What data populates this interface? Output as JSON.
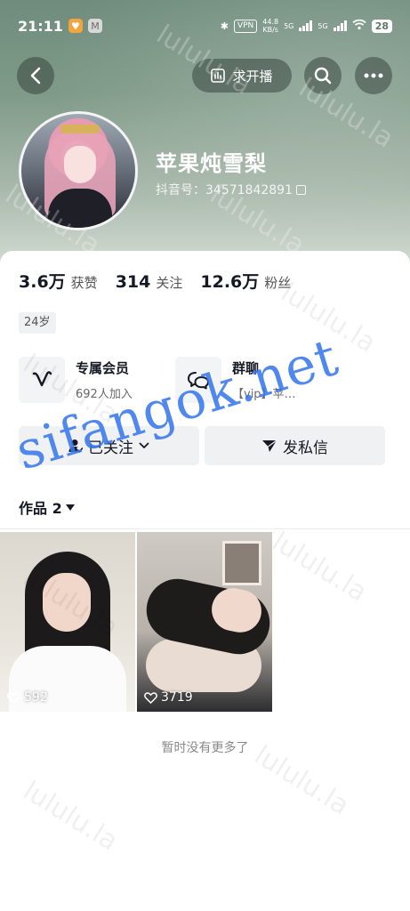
{
  "status_bar": {
    "time": "21:11",
    "vpn": "VPN",
    "net_speed_value": "44.8",
    "net_speed_unit": "KB/s",
    "network_1": "5G",
    "network_2": "5G",
    "battery": "28"
  },
  "nav": {
    "live_request_label": "求开播",
    "icons": [
      "chevron-left-icon",
      "bar-chart-icon",
      "search-icon",
      "more-icon"
    ]
  },
  "profile": {
    "name": "苹果炖雪梨",
    "douyin_id": "抖音号：34571842891"
  },
  "stats": [
    {
      "value": "3.6万",
      "label": "获赞"
    },
    {
      "value": "314",
      "label": "关注"
    },
    {
      "value": "12.6万",
      "label": "粉丝"
    }
  ],
  "tags": {
    "age": "24岁"
  },
  "features": {
    "member": {
      "title": "专属会员",
      "subtitle": "692人加入"
    },
    "group": {
      "title": "群聊",
      "subtitle": "【vip】苹…"
    }
  },
  "actions": {
    "followed": "已关注",
    "message": "发私信"
  },
  "works": {
    "tab_label": "作品 2",
    "items": [
      {
        "likes": "592"
      },
      {
        "likes": "3719"
      }
    ],
    "no_more": "暂时没有更多了"
  },
  "watermarks": {
    "tiled": "lululu.la",
    "site": "sifangok.net"
  },
  "colors": {
    "header_green": "#7f9a89",
    "site_watermark": "#3878eb",
    "text_primary": "#161823"
  }
}
